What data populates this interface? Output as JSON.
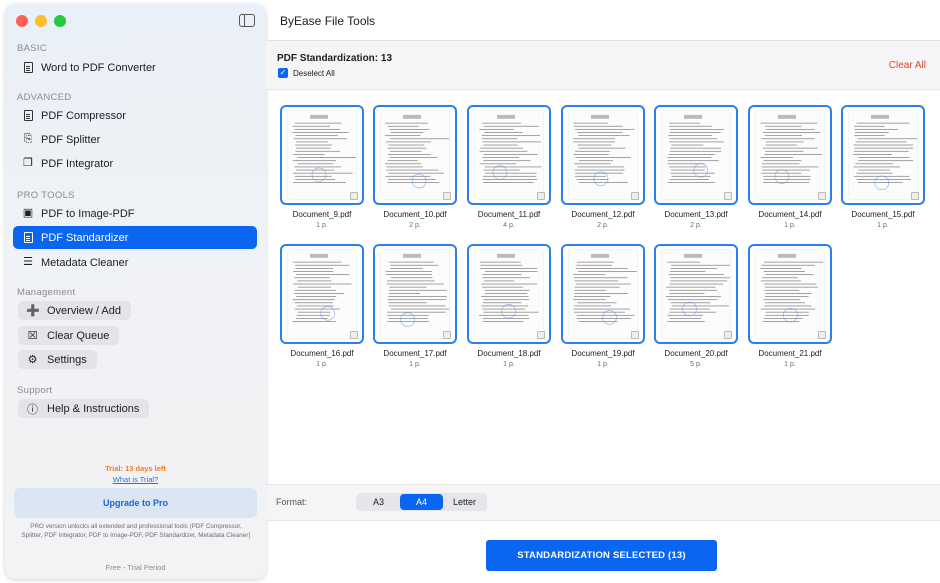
{
  "app": {
    "title": "ByEase File Tools"
  },
  "sidebar": {
    "sections": {
      "basic": "BASIC",
      "advanced": "ADVANCED",
      "pro_tools": "PRO TOOLS",
      "management": "Management",
      "support": "Support"
    },
    "items": [
      {
        "label": "Word to PDF Converter",
        "icon": "document-icon"
      },
      {
        "label": "PDF Compressor",
        "icon": "document-icon"
      },
      {
        "label": "PDF Splitter",
        "icon": "split-icon"
      },
      {
        "label": "PDF Integrator",
        "icon": "merge-icon"
      },
      {
        "label": "PDF to Image-PDF",
        "icon": "image-icon"
      },
      {
        "label": "PDF Standardizer",
        "icon": "standardize-icon",
        "active": true
      },
      {
        "label": "Metadata Cleaner",
        "icon": "metadata-icon"
      }
    ],
    "management": [
      {
        "label": "Overview / Add",
        "icon": "add-folder-icon"
      },
      {
        "label": "Clear Queue",
        "icon": "tray-icon"
      },
      {
        "label": "Settings",
        "icon": "gear-icon"
      }
    ],
    "support": [
      {
        "label": "Help & Instructions",
        "icon": "question-icon"
      }
    ],
    "trial_text": "Trial: 13 days left",
    "what_is_trial": "What is Trial?",
    "upgrade_label": "Upgrade to Pro",
    "pro_note": "PRO version unlocks all extended and professional tools (PDF Compressor, Splitter, PDF Integrator, PDF to Image-PDF, PDF Standardizer, Metadata Cleaner)",
    "footer": "Free - Trial Period"
  },
  "header": {
    "count_label": "PDF Standardization: 13",
    "deselect_label": "Deselect All",
    "clear_all": "Clear All"
  },
  "files": [
    {
      "name": "Document_9.pdf",
      "pages": "1 p."
    },
    {
      "name": "Document_10.pdf",
      "pages": "2 p."
    },
    {
      "name": "Document_11.pdf",
      "pages": "4 p."
    },
    {
      "name": "Document_12.pdf",
      "pages": "2 p."
    },
    {
      "name": "Document_13.pdf",
      "pages": "2 p."
    },
    {
      "name": "Document_14.pdf",
      "pages": "1 p."
    },
    {
      "name": "Document_15.pdf",
      "pages": "1 p."
    },
    {
      "name": "Document_16.pdf",
      "pages": "1 p."
    },
    {
      "name": "Document_17.pdf",
      "pages": "1 p."
    },
    {
      "name": "Document_18.pdf",
      "pages": "1 p."
    },
    {
      "name": "Document_19.pdf",
      "pages": "1 p."
    },
    {
      "name": "Document_20.pdf",
      "pages": "5 p."
    },
    {
      "name": "Document_21.pdf",
      "pages": "1 p."
    }
  ],
  "format": {
    "label": "Format:",
    "options": [
      "A3",
      "A4",
      "Letter"
    ],
    "selected": "A4"
  },
  "action": {
    "label": "STANDARDIZATION SELECTED (13)"
  },
  "colors": {
    "accent": "#0a66f0",
    "danger": "#e0442b",
    "trial": "#f07d1a"
  }
}
